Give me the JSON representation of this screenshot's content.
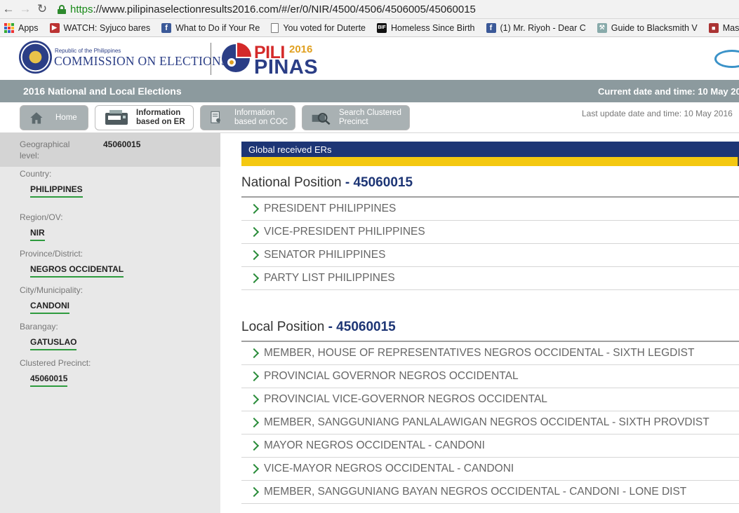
{
  "browser": {
    "url_scheme": "https",
    "url_rest": "://www.pilipinaselectionresults2016.com/#/er/0/NIR/4500/4506/4506005/45060015",
    "bookmarks": [
      {
        "label": "Apps",
        "icon": "apps-grid-icon"
      },
      {
        "label": "WATCH: Syjuco bares",
        "icon": "youtube-icon"
      },
      {
        "label": "What to Do if Your Re",
        "icon": "facebook-icon"
      },
      {
        "label": "You voted for Duterte",
        "icon": "document-icon"
      },
      {
        "label": "Homeless Since Birth",
        "icon": "bif-icon"
      },
      {
        "label": "(1) Mr. Riyoh - Dear C",
        "icon": "facebook-icon"
      },
      {
        "label": "Guide to Blacksmith V",
        "icon": "blacksmith-icon"
      },
      {
        "label": "Master Acco",
        "icon": "master-icon"
      }
    ]
  },
  "header": {
    "republic_text": "Republic of the Philippines",
    "commission_text": "COMMISSION ON ELECTIONS",
    "logo_pili": "PILI",
    "logo_year": "2016",
    "logo_pinas": "PINAS"
  },
  "election_bar": {
    "title": "2016 National and Local Elections",
    "current_time": "Current date and time: 10 May 20"
  },
  "tabs": [
    {
      "label": "Home",
      "icon": "home-icon",
      "active": false
    },
    {
      "label": "Information based on ER",
      "line1": "Information",
      "line2": "based on ER",
      "icon": "er-machine-icon",
      "active": true
    },
    {
      "label": "Information based on COC",
      "line1": "Information",
      "line2": "based on COC",
      "icon": "coc-document-icon",
      "active": false
    },
    {
      "label": "Search Clustered Precinct",
      "line1": "Search Clustered",
      "line2": "Precinct",
      "icon": "search-precinct-icon",
      "active": false
    }
  ],
  "last_update": "Last update date and time: 10 May 2016",
  "sidebar": {
    "geo_label": "Geographical level:",
    "geo_value": "45060015",
    "fields": [
      {
        "label": "Country:",
        "value": "PHILIPPINES"
      },
      {
        "label": "Region/OV:",
        "value": "NIR"
      },
      {
        "label": "Province/District:",
        "value": "NEGROS OCCIDENTAL"
      },
      {
        "label": "City/Municipality:",
        "value": "CANDONI"
      },
      {
        "label": "Barangay:",
        "value": "GATUSLAO"
      },
      {
        "label": "Clustered Precinct:",
        "value": "45060015"
      }
    ]
  },
  "main": {
    "global_title": "Global received ERs",
    "national": {
      "title": "National Position",
      "code": "- 45060015",
      "items": [
        "PRESIDENT PHILIPPINES",
        "VICE-PRESIDENT PHILIPPINES",
        "SENATOR PHILIPPINES",
        "PARTY LIST PHILIPPINES"
      ]
    },
    "local": {
      "title": "Local Position",
      "code": "- 45060015",
      "items": [
        "MEMBER, HOUSE OF REPRESENTATIVES NEGROS OCCIDENTAL - SIXTH LEGDIST",
        "PROVINCIAL GOVERNOR NEGROS OCCIDENTAL",
        "PROVINCIAL VICE-GOVERNOR NEGROS OCCIDENTAL",
        "MEMBER, SANGGUNIANG PANLALAWIGAN NEGROS OCCIDENTAL - SIXTH PROVDIST",
        "MAYOR NEGROS OCCIDENTAL - CANDONI",
        "VICE-MAYOR NEGROS OCCIDENTAL - CANDONI",
        "MEMBER, SANGGUNIANG BAYAN NEGROS OCCIDENTAL - CANDONI - LONE DIST"
      ]
    }
  },
  "colors": {
    "navy": "#1d3575",
    "yellow": "#f4c811",
    "green": "#2e9b3e",
    "gray_bar": "#8c9a9e"
  }
}
